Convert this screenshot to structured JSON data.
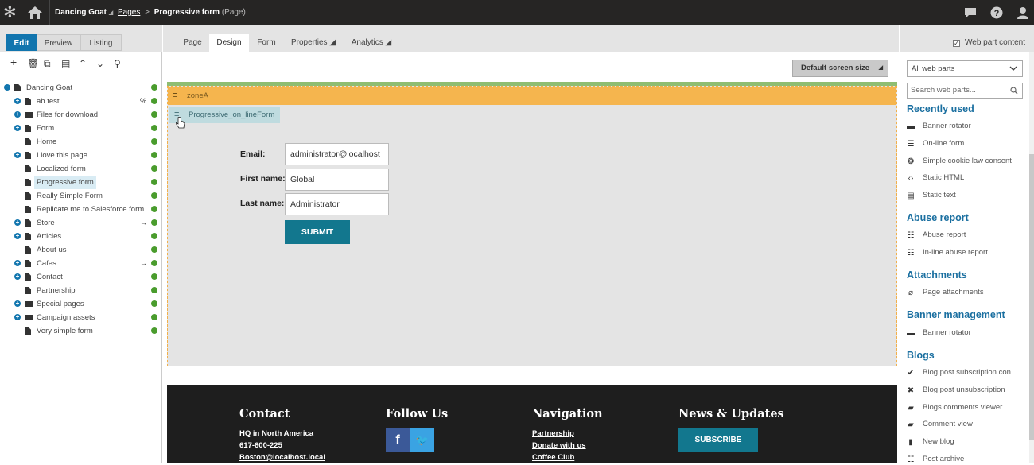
{
  "topbar": {
    "site_name": "Dancing Goat",
    "site_caret": "◢",
    "breadcrumb_pages": "Pages",
    "breadcrumb_sep": ">",
    "breadcrumb_current": "Progressive form",
    "breadcrumb_type": "(Page)",
    "icons": [
      "kentico-logo-icon",
      "home-icon",
      "chat-icon",
      "help-icon",
      "user-icon"
    ]
  },
  "left": {
    "modes": [
      "Edit",
      "Preview",
      "Listing"
    ],
    "active_mode": "Edit",
    "tools": [
      "+",
      "🗑",
      "⧉",
      "▤",
      "⌃",
      "⌄",
      "⚲"
    ],
    "tree": [
      {
        "label": "Dancing Goat",
        "expand": "−",
        "icon": "site",
        "mark": ""
      },
      {
        "label": "ab test",
        "expand": "+",
        "icon": "page",
        "mark": "%"
      },
      {
        "label": "Files for download",
        "expand": "+",
        "icon": "folder",
        "mark": ""
      },
      {
        "label": "Form",
        "expand": "+",
        "icon": "page",
        "mark": ""
      },
      {
        "label": "Home",
        "expand": "",
        "icon": "page",
        "mark": ""
      },
      {
        "label": "I love this page",
        "expand": "+",
        "icon": "page",
        "mark": ""
      },
      {
        "label": "Localized form",
        "expand": "",
        "icon": "page",
        "mark": ""
      },
      {
        "label": "Progressive form",
        "expand": "",
        "icon": "page",
        "mark": "",
        "selected": true
      },
      {
        "label": "Really Simple Form",
        "expand": "",
        "icon": "page",
        "mark": ""
      },
      {
        "label": "Replicate me to Salesforce form",
        "expand": "",
        "icon": "page",
        "mark": ""
      },
      {
        "label": "Store",
        "expand": "+",
        "icon": "page",
        "mark": "→"
      },
      {
        "label": "Articles",
        "expand": "+",
        "icon": "page",
        "mark": ""
      },
      {
        "label": "About us",
        "expand": "",
        "icon": "page",
        "mark": ""
      },
      {
        "label": "Cafes",
        "expand": "+",
        "icon": "page",
        "mark": "→"
      },
      {
        "label": "Contact",
        "expand": "+",
        "icon": "page",
        "mark": ""
      },
      {
        "label": "Partnership",
        "expand": "",
        "icon": "page",
        "mark": ""
      },
      {
        "label": "Special pages",
        "expand": "+",
        "icon": "folder",
        "mark": ""
      },
      {
        "label": "Campaign assets",
        "expand": "+",
        "icon": "folder",
        "mark": ""
      },
      {
        "label": "Very simple form",
        "expand": "",
        "icon": "page",
        "mark": ""
      }
    ]
  },
  "center": {
    "tabs": [
      "Page",
      "Design",
      "Form",
      "Properties ◢",
      "Analytics ◢"
    ],
    "active_tab": "Design",
    "screen_size": "Default screen size",
    "screen_size_caret": "◢",
    "zone_name": "zoneA",
    "webpart_name": "Progressive_on_lineForm",
    "form": {
      "email_label": "Email:",
      "email_value": "administrator@localhost",
      "first_label": "First name:",
      "first_value": "Global",
      "last_label": "Last name:",
      "last_value": "Administrator",
      "submit": "SUBMIT"
    },
    "footer": {
      "contact_title": "Contact",
      "contact_lines": [
        "HQ in North America",
        "617-600-225"
      ],
      "contact_email": "Boston@localhost.local",
      "follow_title": "Follow Us",
      "facebook": "f",
      "twitter": "🐦",
      "nav_title": "Navigation",
      "nav_links": [
        "Partnership",
        "Donate with us",
        "Coffee Club"
      ],
      "news_title": "News & Updates",
      "subscribe": "SUBSCRIBE"
    }
  },
  "right": {
    "webpart_content_label": "Web part content",
    "webpart_content_checked": true,
    "select_value": "All web parts",
    "search_placeholder": "Search web parts...",
    "categories": [
      {
        "title": "Recently used",
        "items": [
          {
            "label": "Banner rotator",
            "icon": "banner-icon"
          },
          {
            "label": "On-line form",
            "icon": "form-icon"
          },
          {
            "label": "Simple cookie law consent",
            "icon": "cookie-icon"
          },
          {
            "label": "Static HTML",
            "icon": "code-icon"
          },
          {
            "label": "Static text",
            "icon": "text-icon"
          }
        ]
      },
      {
        "title": "Abuse report",
        "items": [
          {
            "label": "Abuse report",
            "icon": "list-icon"
          },
          {
            "label": "In-line abuse report",
            "icon": "list-icon"
          }
        ]
      },
      {
        "title": "Attachments",
        "items": [
          {
            "label": "Page attachments",
            "icon": "paperclip-icon"
          }
        ]
      },
      {
        "title": "Banner management",
        "items": [
          {
            "label": "Banner rotator",
            "icon": "banner-icon"
          }
        ]
      },
      {
        "title": "Blogs",
        "items": [
          {
            "label": "Blog post subscription con...",
            "icon": "check-circle-icon"
          },
          {
            "label": "Blog post unsubscription",
            "icon": "x-circle-icon"
          },
          {
            "label": "Blogs comments viewer",
            "icon": "comments-icon"
          },
          {
            "label": "Comment view",
            "icon": "comment-icon"
          },
          {
            "label": "New blog",
            "icon": "new-page-icon"
          },
          {
            "label": "Post archive",
            "icon": "list-icon"
          }
        ]
      }
    ]
  }
}
